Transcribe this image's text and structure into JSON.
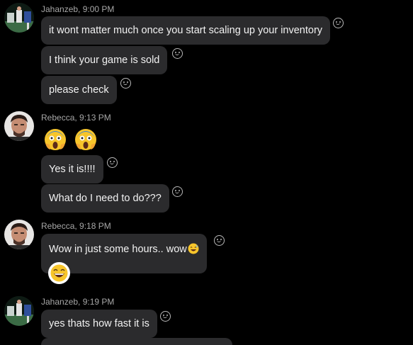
{
  "messages": [
    {
      "sender": "Jahanzeb, 9:00 PM",
      "avatar": "jahanzeb-avatar",
      "bubbles": [
        "it wont matter much once you start scaling up your inventory",
        "I think your game is sold",
        "please check"
      ]
    },
    {
      "sender": "Rebecca, 9:13 PM",
      "avatar": "rebecca-avatar",
      "emojis": [
        "screaming-face-emoji",
        "screaming-face-emoji"
      ],
      "bubbles": [
        "Yes it is!!!!",
        "What do I need to do???"
      ]
    },
    {
      "sender": "Rebecca, 9:18 PM",
      "avatar": "rebecca-avatar",
      "bubbles": [
        "Wow in just some hours.. wow"
      ],
      "inline_emoji": "grinning-sweat-emoji",
      "reaction_emoji": "laughing-face-emoji"
    },
    {
      "sender": "Jahanzeb, 9:19 PM",
      "avatar": "jahanzeb-avatar",
      "bubbles": [
        "yes thats how fast it is"
      ]
    }
  ],
  "icons": {
    "react": "smiley-react-icon"
  },
  "colors": {
    "background": "#000000",
    "bubble": "#2b2b2d",
    "text": "#f2f2f2",
    "meta": "#a7a7a7"
  }
}
